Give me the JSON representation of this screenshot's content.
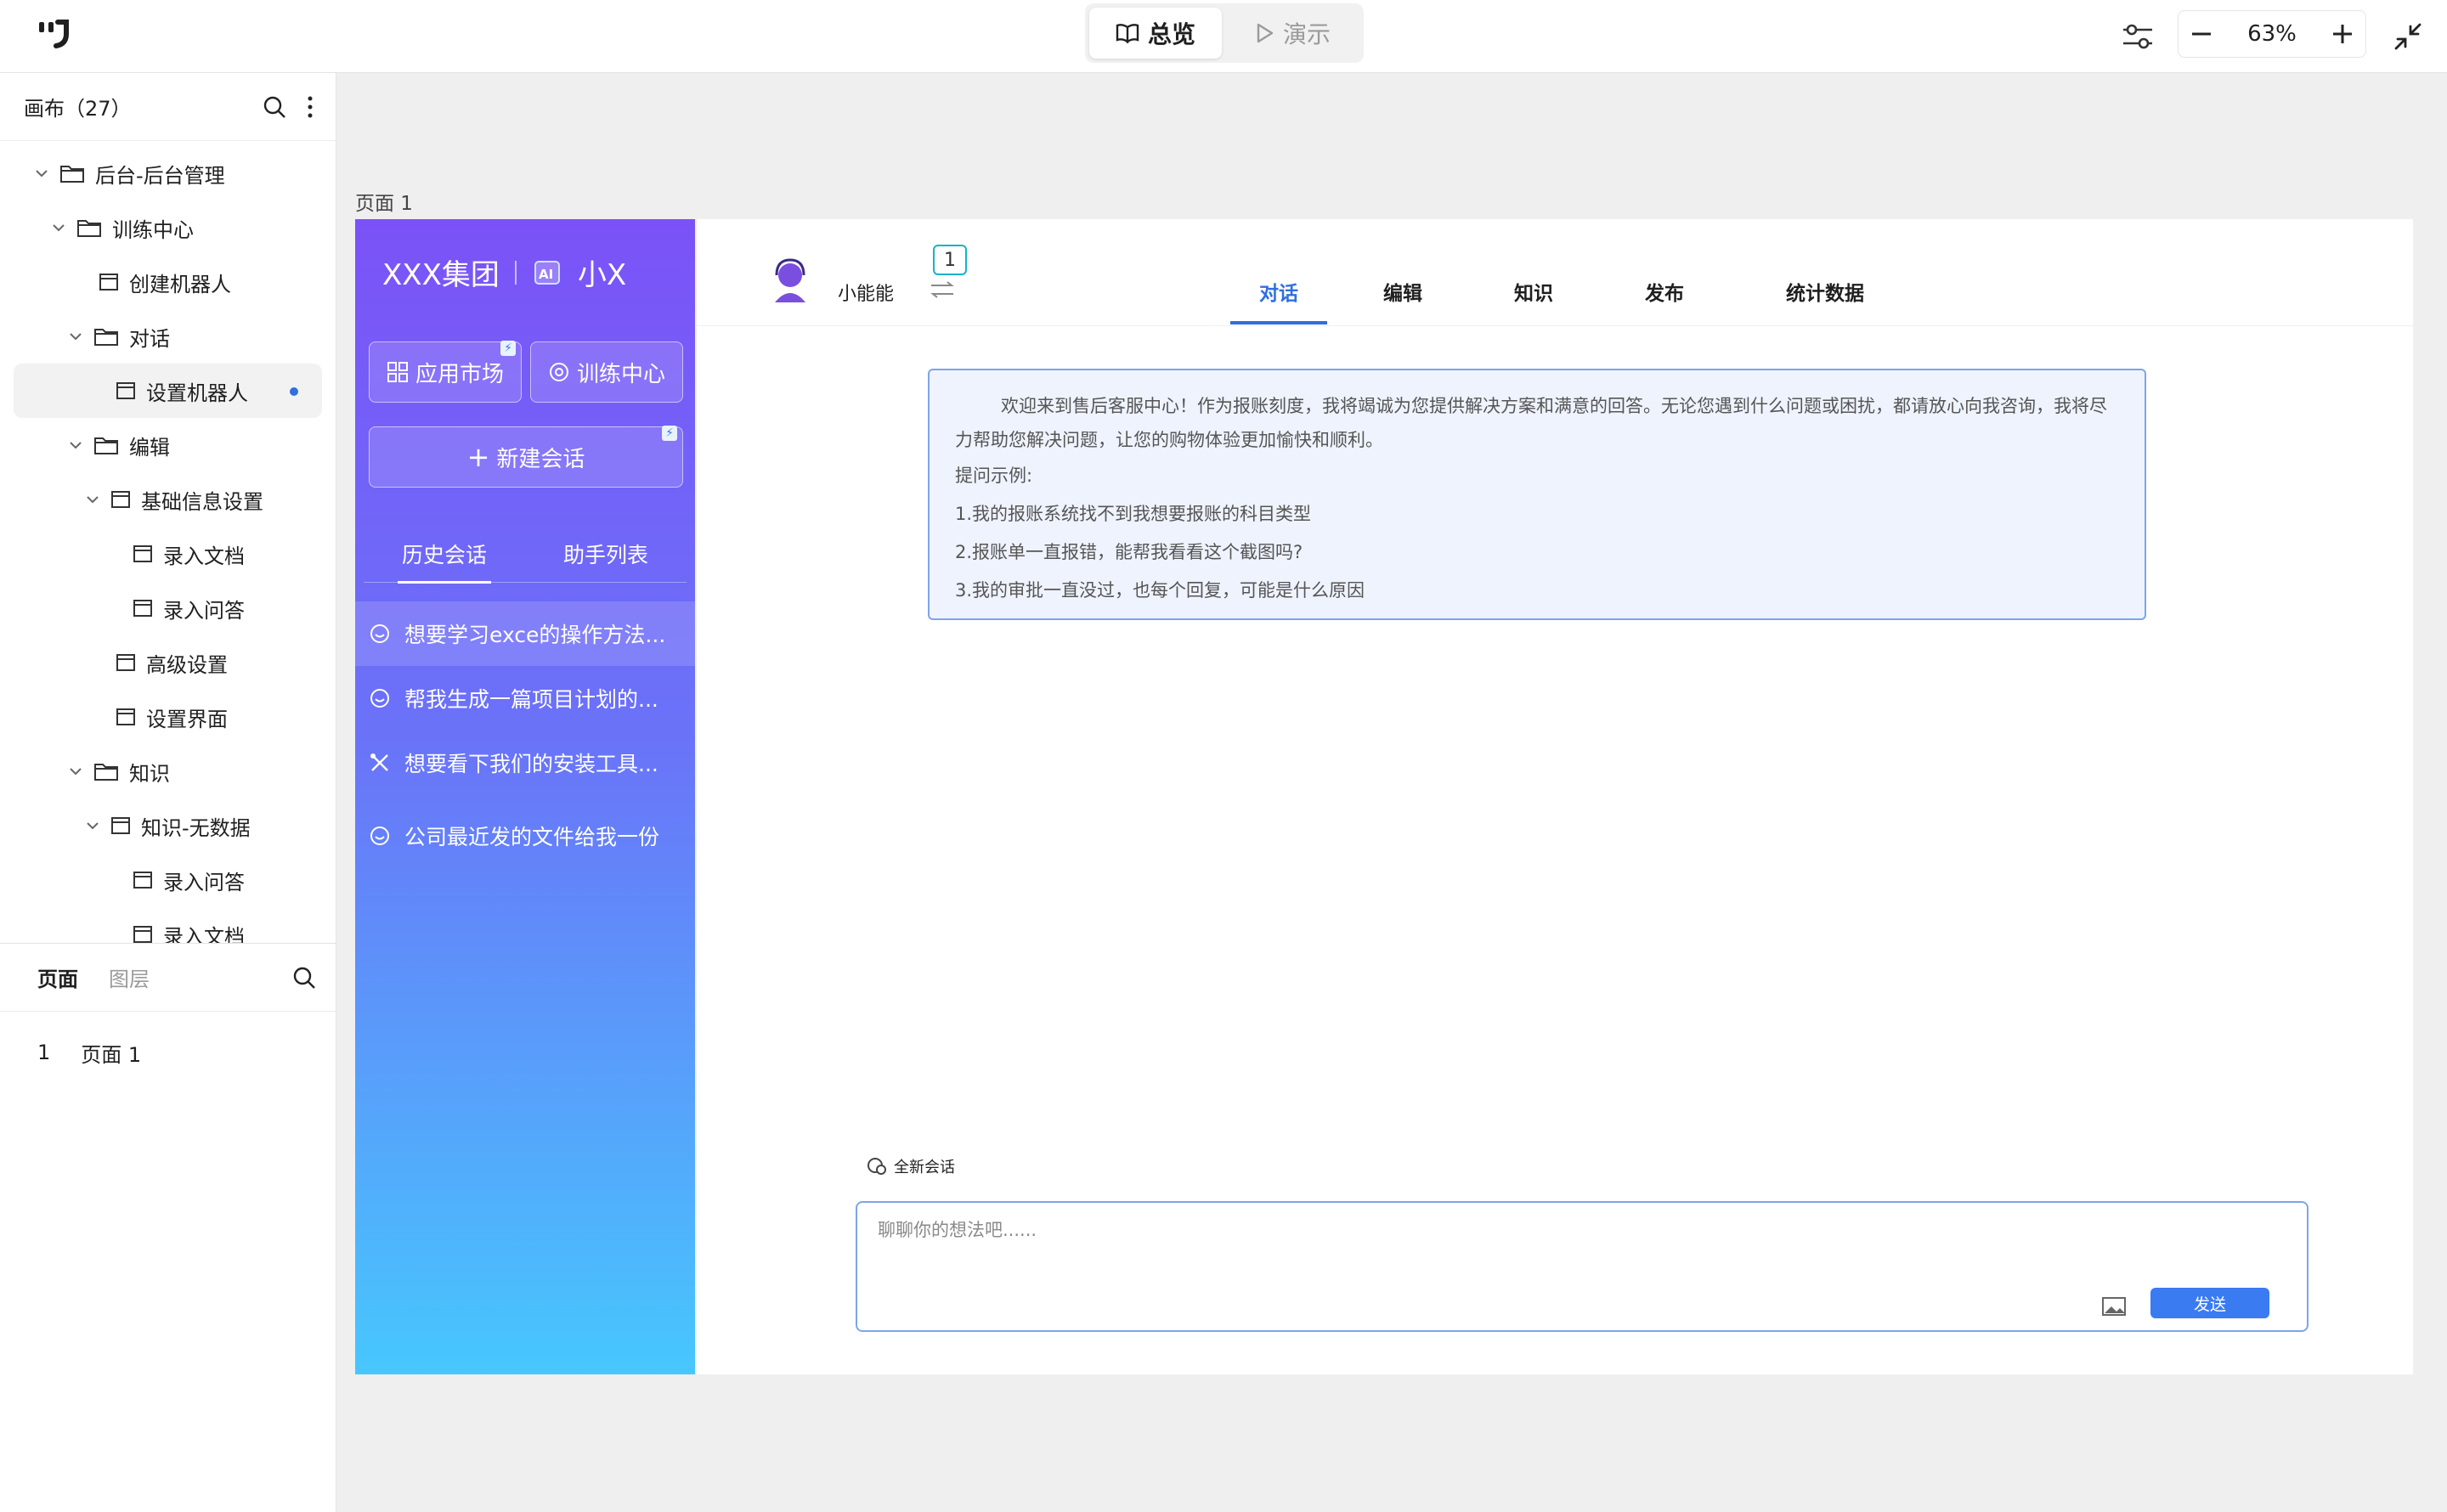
{
  "topbar": {
    "mode_overview": "总览",
    "mode_present": "演示",
    "zoom": "63%"
  },
  "left_panel": {
    "title": "画布（27）",
    "tree": [
      {
        "label": "后台-后台管理",
        "type": "folder",
        "level": 0,
        "expanded": true
      },
      {
        "label": "训练中心",
        "type": "folder",
        "level": 1,
        "expanded": true
      },
      {
        "label": "创建机器人",
        "type": "page",
        "level": 2
      },
      {
        "label": "对话",
        "type": "folder",
        "level": 2,
        "expanded": true
      },
      {
        "label": "设置机器人",
        "type": "page",
        "level": 3,
        "selected": true
      },
      {
        "label": "编辑",
        "type": "folder",
        "level": 2,
        "expanded": true
      },
      {
        "label": "基础信息设置",
        "type": "page",
        "level": 3,
        "expanded": true
      },
      {
        "label": "录入文档",
        "type": "page",
        "level": 4
      },
      {
        "label": "录入问答",
        "type": "page",
        "level": 4
      },
      {
        "label": "高级设置",
        "type": "page",
        "level": 3
      },
      {
        "label": "设置界面",
        "type": "page",
        "level": 3
      },
      {
        "label": "知识",
        "type": "folder",
        "level": 2,
        "expanded": true
      },
      {
        "label": "知识-无数据",
        "type": "page",
        "level": 3,
        "expanded": true
      },
      {
        "label": "录入问答",
        "type": "page",
        "level": 4
      },
      {
        "label": "录入文档",
        "type": "page",
        "level": 4
      }
    ],
    "bottom_tabs": {
      "pages": "页面",
      "layers": "图层"
    },
    "pages": [
      {
        "index": "1",
        "name": "页面 1"
      }
    ]
  },
  "canvas": {
    "page_label": "页面 1",
    "sidebar": {
      "brand": "XXX集团",
      "product": "小X",
      "app_market": "应用市场",
      "training_center": "训练中心",
      "new_chat": "新建会话",
      "tab_history": "历史会话",
      "tab_assistants": "助手列表",
      "history": [
        {
          "text": "想要学习exce的操作方法...",
          "icon": "chat-bubble-icon",
          "selected": true
        },
        {
          "text": "帮我生成一篇项目计划的...",
          "icon": "chat-bubble-icon"
        },
        {
          "text": "想要看下我们的安装工具...",
          "icon": "tools-icon"
        },
        {
          "text": "公司最近发的文件给我一份",
          "icon": "chat-bubble-icon"
        }
      ]
    },
    "main": {
      "bot_name": "小能能",
      "badge_count": "1",
      "tabs": [
        "对话",
        "编辑",
        "知识",
        "发布",
        "统计数据"
      ],
      "active_tab": 0,
      "welcome": {
        "intro": "欢迎来到售后客服中心！作为报账刻度，我将竭诚为您提供解决方案和满意的回答。无论您遇到什么问题或困扰，都请放心向我咨询，我将尽力帮助您解决问题，让您的购物体验更加愉快和顺利。",
        "examples_title": "提问示例:",
        "examples": [
          "1.我的报账系统找不到我想要报账的科目类型",
          "2.报账单一直报错，能帮我看看这个截图吗?",
          "3.我的审批一直没过，也每个回复，可能是什么原因"
        ]
      },
      "new_conversation": "全新会话",
      "input_placeholder": "聊聊你的想法吧......",
      "send": "发送"
    }
  },
  "colors": {
    "accent": "#2f6fe0",
    "sidebar_top": "#7b52f7",
    "sidebar_bottom": "#47c7fd",
    "welcome_border": "#7da5ea"
  }
}
